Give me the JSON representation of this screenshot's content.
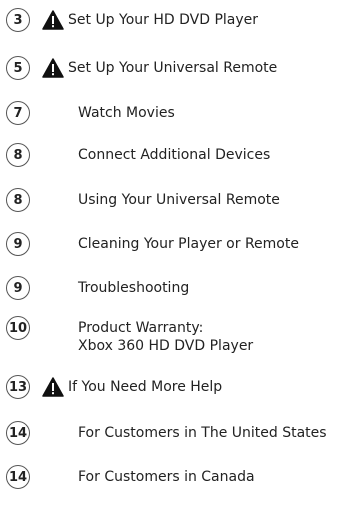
{
  "toc": {
    "entries": [
      {
        "page": "3",
        "title": "Set Up Your HD DVD Player",
        "warning": true
      },
      {
        "page": "5",
        "title": "Set Up Your Universal Remote",
        "warning": true
      },
      {
        "page": "7",
        "title": "Watch Movies",
        "warning": false
      },
      {
        "page": "8",
        "title": "Connect Additional Devices",
        "warning": false
      },
      {
        "page": "8",
        "title": "Using Your Universal Remote",
        "warning": false
      },
      {
        "page": "9",
        "title": "Cleaning Your Player or Remote",
        "warning": false
      },
      {
        "page": "9",
        "title": "Troubleshooting",
        "warning": false
      },
      {
        "page": "10",
        "title": "Product Warranty:",
        "title_line2": "Xbox 360 HD DVD Player",
        "warning": false
      },
      {
        "page": "13",
        "title": "If You Need More Help",
        "warning": true
      },
      {
        "page": "14",
        "title": "For Customers in The United States",
        "warning": false
      },
      {
        "page": "14",
        "title": "For Customers in Canada",
        "warning": false
      }
    ],
    "warning_icon": "warning-triangle-icon"
  }
}
